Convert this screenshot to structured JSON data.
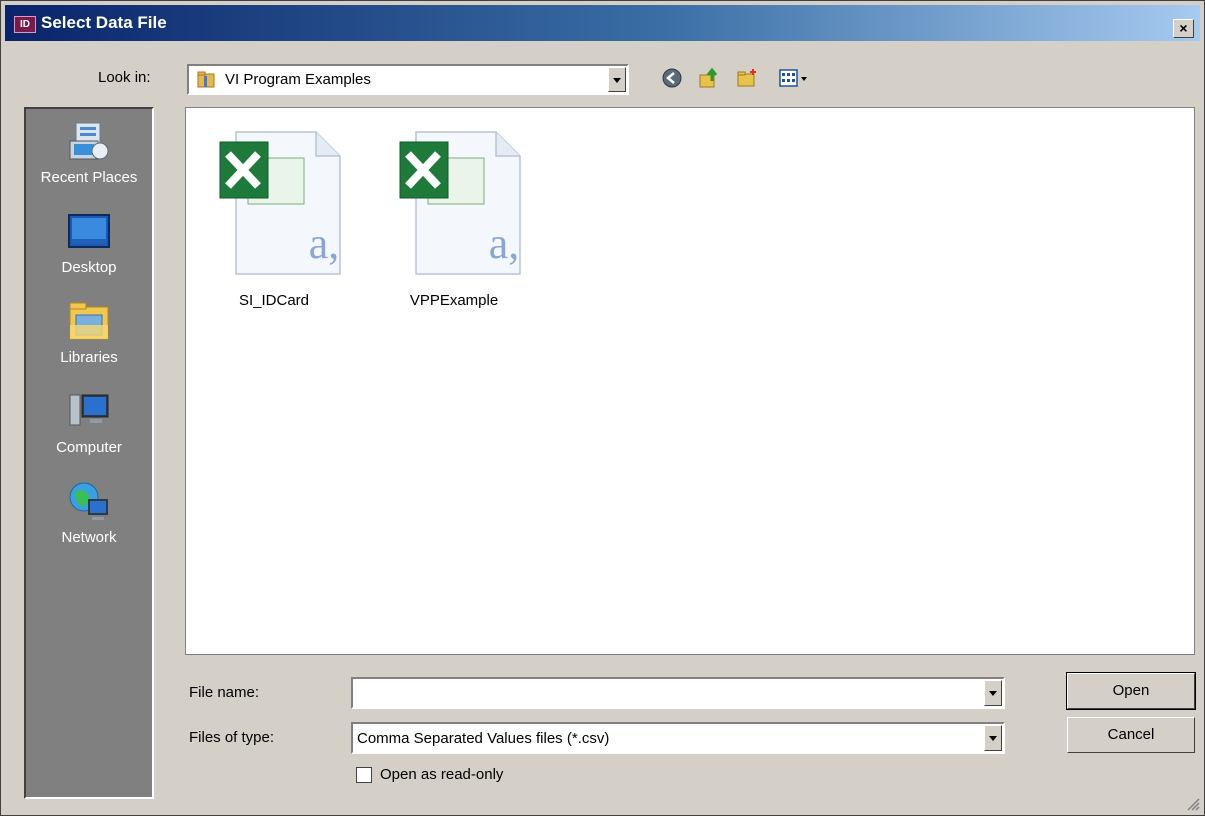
{
  "window": {
    "title": "Select Data File",
    "app_icon_text": "ID",
    "close_label": "×",
    "accent": "#0a246a"
  },
  "toolbar": {
    "lookin_label": "Look in:",
    "lookin_value": "VI Program Examples",
    "icons": [
      "back-icon",
      "up-folder-icon",
      "new-folder-icon",
      "views-icon"
    ]
  },
  "places": [
    {
      "label": "Recent Places",
      "icon": "recent-places-icon"
    },
    {
      "label": "Desktop",
      "icon": "desktop-icon"
    },
    {
      "label": "Libraries",
      "icon": "libraries-icon"
    },
    {
      "label": "Computer",
      "icon": "computer-icon"
    },
    {
      "label": "Network",
      "icon": "network-icon"
    }
  ],
  "files": [
    {
      "name": "SI_IDCard",
      "icon": "csv-file-icon"
    },
    {
      "name": "VPPExample",
      "icon": "csv-file-icon"
    }
  ],
  "form": {
    "filename_label": "File name:",
    "filename_value": "",
    "filetype_label": "Files of type:",
    "filetype_value": "Comma Separated Values files (*.csv)",
    "readonly_label": "Open as read-only",
    "readonly_checked": false
  },
  "buttons": {
    "open": "Open",
    "cancel": "Cancel"
  }
}
